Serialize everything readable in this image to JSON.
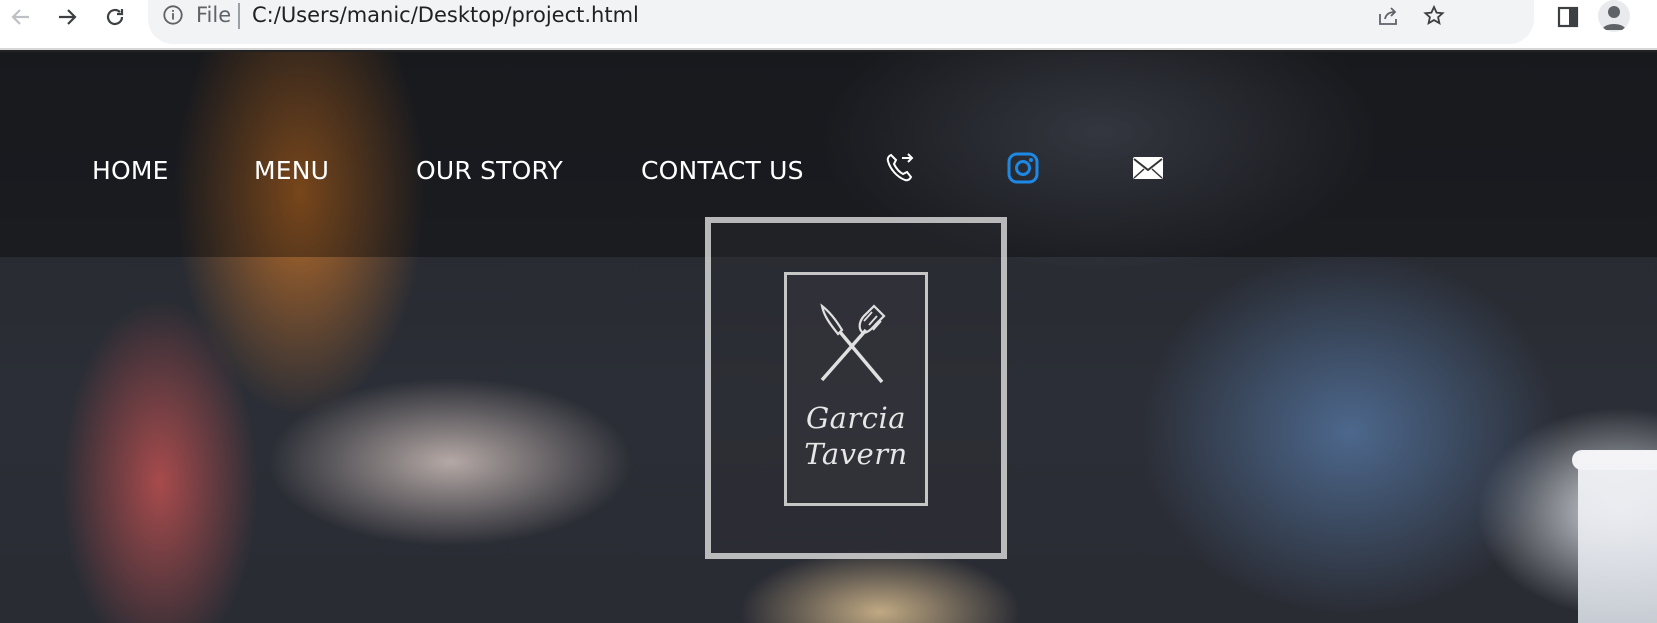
{
  "browser": {
    "scheme_label": "File",
    "url": "C:/Users/manic/Desktop/project.html",
    "icons": [
      "back-arrow-icon",
      "forward-arrow-icon",
      "reload-icon",
      "info-icon",
      "share-icon",
      "star-icon",
      "side-panel-icon",
      "profile-icon"
    ]
  },
  "nav": {
    "items": [
      {
        "label": "HOME"
      },
      {
        "label": "MENU"
      },
      {
        "label": "OUR STORY"
      },
      {
        "label": "CONTACT US"
      }
    ],
    "social_icons": [
      "phone-icon",
      "instagram-icon",
      "email-icon"
    ],
    "instagram_color": "#1e88e5"
  },
  "logo": {
    "line1": "Garcia",
    "line2": "Tavern",
    "icon": "cutlery-icon"
  }
}
